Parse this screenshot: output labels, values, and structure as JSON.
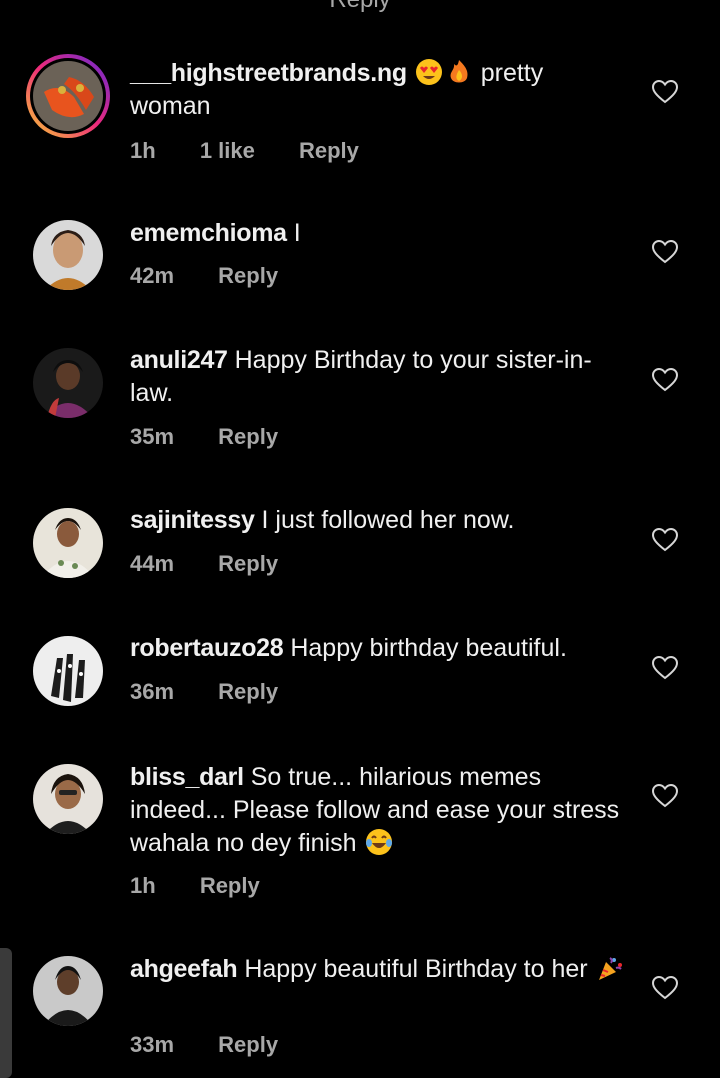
{
  "top_cut_text": "Reply",
  "comments": [
    {
      "username": "___highstreetbrands.ng",
      "text_before": "",
      "text_after": "pretty woman",
      "time": "1h",
      "likes": "1 like",
      "reply": "Reply",
      "emoji": [
        "heart-eyes-emoji",
        "fire-emoji"
      ]
    },
    {
      "username": "ememchioma",
      "text": "I",
      "time": "42m",
      "reply": "Reply"
    },
    {
      "username": "anuli247",
      "text": "Happy Birthday to your sister-in-law.",
      "time": "35m",
      "reply": "Reply"
    },
    {
      "username": "sajinitessy",
      "text": "I just followed her now.",
      "time": "44m",
      "reply": "Reply"
    },
    {
      "username": "robertauzo28",
      "text": "Happy birthday beautiful.",
      "time": "36m",
      "reply": "Reply"
    },
    {
      "username": "bliss_darl",
      "text": "So true... hilarious memes indeed... Please follow and ease your stress wahala no dey finish",
      "time": "1h",
      "reply": "Reply",
      "emoji": [
        "laughing-tears-emoji"
      ]
    },
    {
      "username": "ahgeefah",
      "text": "Happy beautiful Birthday to her",
      "time": "33m",
      "reply": "Reply",
      "emoji": [
        "party-popper-emoji"
      ]
    }
  ],
  "colors": {
    "background": "#000000",
    "text": "#f0f0f0",
    "muted": "#a8a8a8",
    "story_ring_start": "#f9ce34",
    "story_ring_end": "#ee2a7b"
  }
}
